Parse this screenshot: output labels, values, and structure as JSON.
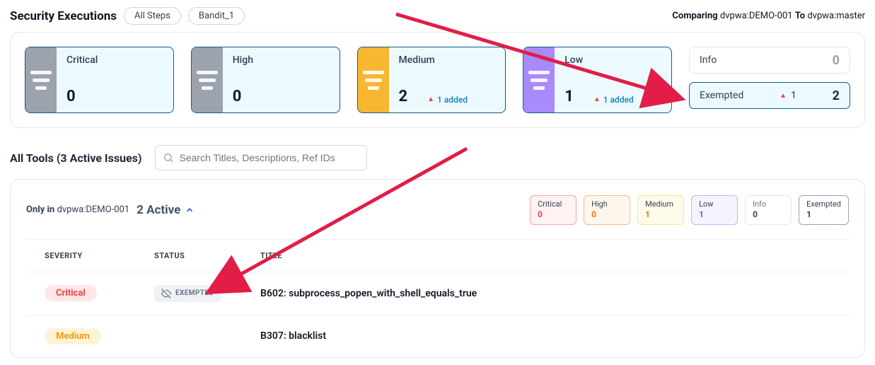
{
  "header": {
    "title": "Security Executions",
    "chips": [
      "All Steps",
      "Bandit_1"
    ],
    "compare": {
      "prefix": "Comparing",
      "left": "dvpwa:DEMO-001",
      "mid": "To",
      "right": "dvpwa:master"
    }
  },
  "summary": {
    "tiles": [
      {
        "label": "Critical",
        "count": "0",
        "stripe": "gray",
        "delta": null
      },
      {
        "label": "High",
        "count": "0",
        "stripe": "gray",
        "delta": null
      },
      {
        "label": "Medium",
        "count": "2",
        "stripe": "yellow",
        "delta": "1 added"
      },
      {
        "label": "Low",
        "count": "1",
        "stripe": "purple",
        "delta": "1 added"
      }
    ],
    "info": {
      "label": "Info",
      "count": "0"
    },
    "exempted": {
      "label": "Exempted",
      "delta": "1",
      "count": "2"
    }
  },
  "tools": {
    "heading": "All Tools (3 Active Issues)",
    "search_placeholder": "Search Titles, Descriptions, Ref IDs"
  },
  "issues": {
    "only_in_prefix": "Only in",
    "only_in_target": "dvpwa:DEMO-001",
    "active_label": "2 Active",
    "mini": {
      "critical": {
        "label": "Critical",
        "value": "0"
      },
      "high": {
        "label": "High",
        "value": "0"
      },
      "medium": {
        "label": "Medium",
        "value": "1"
      },
      "low": {
        "label": "Low",
        "value": "1"
      },
      "info": {
        "label": "Info",
        "value": "0"
      },
      "exempted": {
        "label": "Exempted",
        "value": "1"
      }
    },
    "columns": {
      "severity": "SEVERITY",
      "status": "STATUS",
      "title": "TITLE"
    },
    "rows": [
      {
        "severity": "Critical",
        "sev_class": "crit",
        "status": "EXEMPTED",
        "title": "B602: subprocess_popen_with_shell_equals_true"
      },
      {
        "severity": "Medium",
        "sev_class": "med",
        "status": "",
        "title": "B307: blacklist"
      }
    ]
  }
}
